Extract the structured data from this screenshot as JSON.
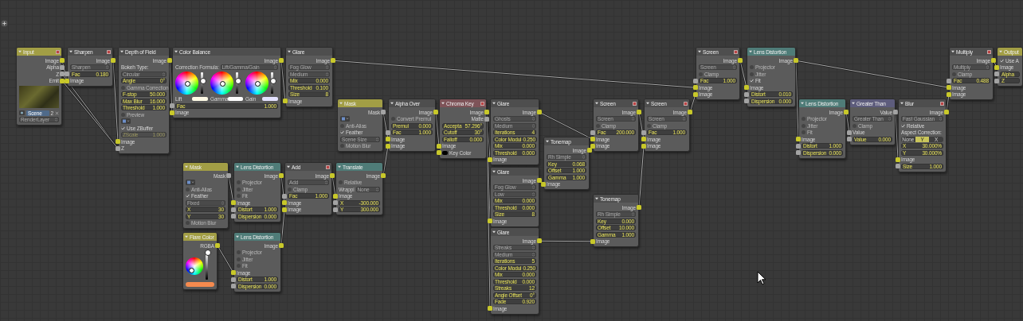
{
  "nodes": [
    {
      "title": "Input",
      "kind": "input",
      "has_header_icon": true,
      "rows": [
        {
          "kind": "out",
          "label": "Image",
          "socket": {
            "color": "#c8c82a"
          }
        },
        {
          "kind": "out",
          "label": "Alpha",
          "socket": {
            "color": "#a3a3a3"
          }
        },
        {
          "kind": "out",
          "label": "Z",
          "socket": {
            "color": "#a3a3a3"
          }
        },
        {
          "kind": "out",
          "label": "Emit",
          "socket": {
            "color": "#c8c82a"
          }
        },
        {
          "kind": "preview"
        },
        {
          "kind": "scene",
          "value": "Scene",
          "users": "2"
        },
        {
          "kind": "dropdown",
          "value": "RenderLayer"
        }
      ]
    },
    {
      "title": "Sharpen",
      "kind": "filter",
      "has_header_icon": true,
      "rows": [
        {
          "kind": "out",
          "label": "Image",
          "socket": {
            "color": "#c8c82a"
          }
        },
        {
          "kind": "dropdown",
          "value": "Sharpen"
        },
        {
          "kind": "field",
          "label": "Fac",
          "value": "0.180",
          "socket": {
            "color": "#a3a3a3"
          }
        },
        {
          "kind": "in",
          "label": "Image",
          "socket": {
            "color": "#c8c82a"
          }
        }
      ]
    },
    {
      "title": "Depth of Field",
      "kind": "filter",
      "rows": [
        {
          "kind": "out",
          "label": "Image",
          "socket": {
            "color": "#c8c82a"
          }
        },
        {
          "kind": "label",
          "label": "Bokeh Type:"
        },
        {
          "kind": "dropdown",
          "value": "Circular"
        },
        {
          "kind": "field",
          "label": "Angle",
          "value": "0°"
        },
        {
          "kind": "check",
          "label": "Gamma Correction",
          "checked": false
        },
        {
          "kind": "field",
          "label": "F-stop",
          "value": "50.000"
        },
        {
          "kind": "field",
          "label": "Max Blur",
          "value": "16.000"
        },
        {
          "kind": "field",
          "label": "Threshold",
          "value": "1.000"
        },
        {
          "kind": "check",
          "label": "Preview",
          "checked": false
        },
        {
          "kind": "icon_button"
        },
        {
          "kind": "check",
          "label": "Use ZBuffer",
          "checked": true
        },
        {
          "kind": "field",
          "label": "ZScale",
          "value": "1.000",
          "disabled": true
        },
        {
          "kind": "in",
          "label": "Image",
          "socket": {
            "color": "#c8c82a"
          }
        },
        {
          "kind": "in",
          "label": "Z",
          "socket": {
            "color": "#a3a3a3"
          }
        }
      ]
    },
    {
      "title": "Color Balance",
      "kind": "color",
      "rows": [
        {
          "kind": "out",
          "label": "Image",
          "socket": {
            "color": "#c8c82a"
          }
        },
        {
          "kind": "label_dropdown",
          "label": "Correction Formula:",
          "value": "Lift/Gamma/Gain"
        },
        {
          "kind": "wheels",
          "wheels": [
            {
              "label": "Lift",
              "color": "#fffbe6",
              "level": 0.55
            },
            {
              "label": "Gamma",
              "color": "#ffffff",
              "level": 0.55
            },
            {
              "label": "Gain",
              "color": "#e4e2ff",
              "level": 0.55
            }
          ]
        },
        {
          "kind": "field",
          "label": "Fac",
          "value": "1.000",
          "socket": {
            "color": "#a3a3a3"
          }
        },
        {
          "kind": "in",
          "label": "Image",
          "socket": {
            "color": "#c8c82a"
          }
        }
      ]
    },
    {
      "title": "Glare",
      "kind": "filter",
      "rows": [
        {
          "kind": "out",
          "label": "Image",
          "socket": {
            "color": "#c8c82a"
          }
        },
        {
          "kind": "dropdown",
          "value": "Fog Glow"
        },
        {
          "kind": "dropdown",
          "value": "Medium"
        },
        {
          "kind": "field",
          "label": "Mix",
          "value": "0.000"
        },
        {
          "kind": "field",
          "label": "Threshold",
          "value": "0.100"
        },
        {
          "kind": "field",
          "label": "Size",
          "value": "8"
        },
        {
          "kind": "in",
          "label": "Image",
          "socket": {
            "color": "#c8c82a"
          }
        }
      ]
    },
    {
      "title": "Screen",
      "kind": "color",
      "has_header_icon": true,
      "rows": [
        {
          "kind": "out",
          "label": "Image",
          "socket": {
            "color": "#c8c82a"
          }
        },
        {
          "kind": "dropdown",
          "value": "Screen"
        },
        {
          "kind": "check",
          "label": "Clamp",
          "checked": false
        },
        {
          "kind": "field",
          "label": "Fac",
          "value": "1.000",
          "socket": {
            "color": "#a3a3a3"
          }
        },
        {
          "kind": "in",
          "label": "Image",
          "socket": {
            "color": "#c8c82a"
          }
        },
        {
          "kind": "in",
          "label": "Image",
          "socket": {
            "color": "#c8c82a"
          }
        }
      ]
    },
    {
      "title": "Lens Distortion",
      "kind": "distort",
      "rows": [
        {
          "kind": "out",
          "label": "Image",
          "socket": {
            "color": "#c8c82a"
          }
        },
        {
          "kind": "check",
          "label": "Projector",
          "checked": false
        },
        {
          "kind": "check",
          "label": "Jitter",
          "checked": false
        },
        {
          "kind": "check",
          "label": "Fit",
          "checked": true
        },
        {
          "kind": "in",
          "label": "Image",
          "socket": {
            "color": "#c8c82a"
          }
        },
        {
          "kind": "field",
          "label": "Distort",
          "value": "0.010",
          "socket": {
            "color": "#a3a3a3"
          }
        },
        {
          "kind": "field",
          "label": "Dispersion",
          "value": "0.000",
          "socket": {
            "color": "#a3a3a3"
          }
        }
      ]
    },
    {
      "title": "Multiply",
      "kind": "color",
      "has_header_icon": true,
      "rows": [
        {
          "kind": "out",
          "label": "Image",
          "socket": {
            "color": "#c8c82a"
          }
        },
        {
          "kind": "dropdown",
          "value": "Multiply"
        },
        {
          "kind": "check",
          "label": "Clamp",
          "checked": false
        },
        {
          "kind": "field",
          "label": "Fac",
          "value": "0.488",
          "socket": {
            "color": "#a3a3a3"
          }
        },
        {
          "kind": "in",
          "label": "Image",
          "socket": {
            "color": "#c8c82a"
          }
        },
        {
          "kind": "in",
          "label": "Image",
          "socket": {
            "color": "#c8c82a"
          }
        }
      ]
    },
    {
      "title": "Output",
      "kind": "output",
      "rows": [
        {
          "kind": "check",
          "label": "Use A",
          "checked": true
        },
        {
          "kind": "in",
          "label": "Image",
          "socket": {
            "color": "#c8c82a"
          }
        },
        {
          "kind": "field",
          "label": "Alpha",
          "socket": {
            "color": "#a3a3a3"
          }
        },
        {
          "kind": "field",
          "label": "Z",
          "socket": {
            "color": "#a3a3a3"
          }
        }
      ]
    },
    {
      "title": "Mask",
      "kind": "input",
      "rows": [
        {
          "kind": "out",
          "label": "Mask",
          "socket": {
            "color": "#a3a3a3"
          }
        },
        {
          "kind": "icon_button"
        },
        {
          "kind": "check",
          "label": "Anti-Alias",
          "checked": false
        },
        {
          "kind": "check",
          "label": "Feather",
          "checked": true
        },
        {
          "kind": "dropdown",
          "value": "Scene Size"
        },
        {
          "kind": "check",
          "label": "Motion Blur",
          "checked": false
        }
      ]
    },
    {
      "title": "Alpha Over",
      "kind": "color",
      "rows": [
        {
          "kind": "out",
          "label": "Image",
          "socket": {
            "color": "#c8c82a"
          }
        },
        {
          "kind": "check",
          "label": "Convert Premul",
          "checked": false
        },
        {
          "kind": "field",
          "label": "Premul",
          "value": "0.000"
        },
        {
          "kind": "field",
          "label": "Fac",
          "value": "1.000",
          "socket": {
            "color": "#a3a3a3"
          }
        },
        {
          "kind": "in",
          "label": "Image",
          "socket": {
            "color": "#c8c82a"
          }
        },
        {
          "kind": "in",
          "label": "Image",
          "socket": {
            "color": "#c8c82a"
          }
        }
      ]
    },
    {
      "title": "Chroma Key",
      "kind": "matte",
      "has_header_icon": true,
      "rows": [
        {
          "kind": "out",
          "label": "Image",
          "socket": {
            "color": "#c8c82a"
          }
        },
        {
          "kind": "out",
          "label": "Matte",
          "socket": {
            "color": "#a3a3a3"
          }
        },
        {
          "kind": "field",
          "label": "Accepta",
          "value": "57.296°"
        },
        {
          "kind": "field",
          "label": "Cutoff",
          "value": "30°"
        },
        {
          "kind": "field",
          "label": "Falloff",
          "value": "0.000"
        },
        {
          "kind": "in",
          "label": "Image",
          "socket": {
            "color": "#c8c82a"
          }
        },
        {
          "kind": "in_swatch",
          "label": "Key Color",
          "color": "#000000",
          "socket": {
            "color": "#c8c82a"
          }
        }
      ]
    },
    {
      "title": "Glare",
      "kind": "filter",
      "rows": [
        {
          "kind": "out",
          "label": "Image",
          "socket": {
            "color": "#c8c82a"
          }
        },
        {
          "kind": "dropdown",
          "value": "Ghosts"
        },
        {
          "kind": "dropdown",
          "value": "Medium"
        },
        {
          "kind": "field",
          "label": "Iterations",
          "value": "4"
        },
        {
          "kind": "field",
          "label": "Color Modul",
          "value": "0.250"
        },
        {
          "kind": "field",
          "label": "Mix",
          "value": "0.000"
        },
        {
          "kind": "field",
          "label": "Threshold",
          "value": "0.000"
        },
        {
          "kind": "in",
          "label": "Image",
          "socket": {
            "color": "#c8c82a"
          }
        }
      ]
    },
    {
      "title": "Tonemap",
      "kind": "color",
      "rows": [
        {
          "kind": "out",
          "label": "Image",
          "socket": {
            "color": "#c8c82a"
          }
        },
        {
          "kind": "dropdown",
          "value": "Rh Simple"
        },
        {
          "kind": "field",
          "label": "Key",
          "value": "0.068"
        },
        {
          "kind": "field",
          "label": "Offset",
          "value": "1.000"
        },
        {
          "kind": "field",
          "label": "Gamma",
          "value": "1.000"
        },
        {
          "kind": "in",
          "label": "Image",
          "socket": {
            "color": "#c8c82a"
          }
        }
      ]
    },
    {
      "title": "Screen",
      "kind": "color",
      "has_header_icon": true,
      "rows": [
        {
          "kind": "out",
          "label": "Image",
          "socket": {
            "color": "#c8c82a"
          }
        },
        {
          "kind": "dropdown",
          "value": "Screen"
        },
        {
          "kind": "check",
          "label": "Clamp",
          "checked": false
        },
        {
          "kind": "field",
          "label": "Fac",
          "value": "200.000",
          "socket": {
            "color": "#a3a3a3"
          }
        },
        {
          "kind": "in",
          "label": "Image",
          "socket": {
            "color": "#c8c82a"
          }
        },
        {
          "kind": "in",
          "label": "Image",
          "socket": {
            "color": "#c8c82a"
          }
        }
      ]
    },
    {
      "title": "Screen",
      "kind": "color",
      "has_header_icon": true,
      "rows": [
        {
          "kind": "out",
          "label": "Image",
          "socket": {
            "color": "#c8c82a"
          }
        },
        {
          "kind": "dropdown",
          "value": "Screen"
        },
        {
          "kind": "check",
          "label": "Clamp",
          "checked": false
        },
        {
          "kind": "field",
          "label": "Fac",
          "value": "1.000",
          "socket": {
            "color": "#a3a3a3"
          }
        },
        {
          "kind": "in",
          "label": "Image",
          "socket": {
            "color": "#c8c82a"
          }
        },
        {
          "kind": "in",
          "label": "Image",
          "socket": {
            "color": "#c8c82a"
          }
        }
      ]
    },
    {
      "title": "Glare",
      "kind": "filter",
      "rows": [
        {
          "kind": "out",
          "label": "Image",
          "socket": {
            "color": "#c8c82a"
          }
        },
        {
          "kind": "dropdown",
          "value": "Fog Glow"
        },
        {
          "kind": "dropdown",
          "value": "Low"
        },
        {
          "kind": "field",
          "label": "Mix",
          "value": "0.000"
        },
        {
          "kind": "field",
          "label": "Threshold",
          "value": "0.000"
        },
        {
          "kind": "field",
          "label": "Size",
          "value": "8"
        },
        {
          "kind": "in",
          "label": "Image",
          "socket": {
            "color": "#c8c82a"
          }
        }
      ]
    },
    {
      "title": "Tonemap",
      "kind": "color",
      "rows": [
        {
          "kind": "out",
          "label": "Image",
          "socket": {
            "color": "#c8c82a"
          }
        },
        {
          "kind": "dropdown",
          "value": "Rh Simple"
        },
        {
          "kind": "field",
          "label": "Key",
          "value": "0.000"
        },
        {
          "kind": "field",
          "label": "Offset",
          "value": "10.000"
        },
        {
          "kind": "field",
          "label": "Gamma",
          "value": "1.000"
        },
        {
          "kind": "in",
          "label": "Image",
          "socket": {
            "color": "#c8c82a"
          }
        }
      ]
    },
    {
      "title": "Glare",
      "kind": "filter",
      "rows": [
        {
          "kind": "out",
          "label": "Image",
          "socket": {
            "color": "#c8c82a"
          }
        },
        {
          "kind": "dropdown",
          "value": "Streaks"
        },
        {
          "kind": "dropdown",
          "value": "Medium"
        },
        {
          "kind": "field",
          "label": "Iterations",
          "value": "5"
        },
        {
          "kind": "field",
          "label": "Color Modul",
          "value": "0.250"
        },
        {
          "kind": "field",
          "label": "Mix",
          "value": "0.000"
        },
        {
          "kind": "field",
          "label": "Threshold",
          "value": "0.000"
        },
        {
          "kind": "field",
          "label": "Streaks",
          "value": "12"
        },
        {
          "kind": "field",
          "label": "Angle Offset",
          "value": "0°"
        },
        {
          "kind": "field",
          "label": "Fade",
          "value": "0.920"
        },
        {
          "kind": "in",
          "label": "Image",
          "socket": {
            "color": "#c8c82a"
          }
        }
      ]
    },
    {
      "title": "Lens Distortion",
      "kind": "distort",
      "rows": [
        {
          "kind": "out",
          "label": "Image",
          "socket": {
            "color": "#c8c82a"
          }
        },
        {
          "kind": "check",
          "label": "Projector",
          "checked": false
        },
        {
          "kind": "check",
          "label": "Jitter",
          "checked": false
        },
        {
          "kind": "check",
          "label": "Fit",
          "checked": false
        },
        {
          "kind": "in",
          "label": "Image",
          "socket": {
            "color": "#c8c82a"
          }
        },
        {
          "kind": "field",
          "label": "Distort",
          "value": "1.000",
          "socket": {
            "color": "#a3a3a3"
          }
        },
        {
          "kind": "field",
          "label": "Dispersion",
          "value": "0.000",
          "socket": {
            "color": "#a3a3a3"
          }
        }
      ]
    },
    {
      "title": "Greater Than",
      "kind": "converter",
      "rows": [
        {
          "kind": "out",
          "label": "Value",
          "socket": {
            "color": "#a3a3a3"
          }
        },
        {
          "kind": "dropdown",
          "value": "Greater Than"
        },
        {
          "kind": "check",
          "label": "Clamp",
          "checked": false
        },
        {
          "kind": "in",
          "label": "Value",
          "socket": {
            "color": "#a3a3a3"
          }
        },
        {
          "kind": "field",
          "label": "Value",
          "value": "0.000",
          "socket": {
            "color": "#a3a3a3"
          }
        }
      ]
    },
    {
      "title": "Blur",
      "kind": "filter",
      "has_header_icon": true,
      "rows": [
        {
          "kind": "out",
          "label": "Image",
          "socket": {
            "color": "#c8c82a"
          }
        },
        {
          "kind": "dropdown",
          "value": "Fast Gaussian"
        },
        {
          "kind": "check",
          "label": "Relative",
          "checked": true
        },
        {
          "kind": "label",
          "label": "Aspect Correction:"
        },
        {
          "kind": "segment",
          "options": [
            {
              "label": "None",
              "selected": false
            },
            {
              "label": "Y",
              "selected": true
            },
            {
              "label": "X",
              "selected": false
            }
          ]
        },
        {
          "kind": "field",
          "label": "X",
          "value": "30.000%"
        },
        {
          "kind": "field",
          "label": "Y",
          "value": "30.000%"
        },
        {
          "kind": "in",
          "label": "Image",
          "socket": {
            "color": "#c8c82a"
          }
        },
        {
          "kind": "field",
          "label": "Size",
          "value": "1.000",
          "socket": {
            "color": "#a3a3a3"
          }
        }
      ]
    },
    {
      "title": "Mask",
      "kind": "input",
      "rows": [
        {
          "kind": "out",
          "label": "Mask",
          "socket": {
            "color": "#a3a3a3"
          }
        },
        {
          "kind": "icon_button"
        },
        {
          "kind": "check",
          "label": "Anti-Alias",
          "checked": false
        },
        {
          "kind": "check",
          "label": "Feather",
          "checked": true
        },
        {
          "kind": "dropdown",
          "value": "Fixed"
        },
        {
          "kind": "field",
          "label": "X",
          "value": "30"
        },
        {
          "kind": "field",
          "label": "Y",
          "value": "30"
        },
        {
          "kind": "check",
          "label": "Motion Blur",
          "checked": false
        }
      ]
    },
    {
      "title": "Lens Distortion",
      "kind": "distort",
      "rows": [
        {
          "kind": "out",
          "label": "Image",
          "socket": {
            "color": "#c8c82a"
          }
        },
        {
          "kind": "check",
          "label": "Projector",
          "checked": false
        },
        {
          "kind": "check",
          "label": "Jitter",
          "checked": false
        },
        {
          "kind": "check",
          "label": "Fit",
          "checked": false
        },
        {
          "kind": "in",
          "label": "Image",
          "socket": {
            "color": "#c8c82a"
          }
        },
        {
          "kind": "field",
          "label": "Distort",
          "value": "1.000",
          "socket": {
            "color": "#a3a3a3"
          }
        },
        {
          "kind": "field",
          "label": "Dispersion",
          "value": "0.000",
          "socket": {
            "color": "#a3a3a3"
          }
        }
      ]
    },
    {
      "title": "Add",
      "kind": "color",
      "has_header_icon": true,
      "rows": [
        {
          "kind": "out",
          "label": "Image",
          "socket": {
            "color": "#c8c82a"
          }
        },
        {
          "kind": "dropdown",
          "value": "Add"
        },
        {
          "kind": "check",
          "label": "Clamp",
          "checked": false
        },
        {
          "kind": "field",
          "label": "Fac",
          "value": "1.000",
          "socket": {
            "color": "#a3a3a3"
          }
        },
        {
          "kind": "in",
          "label": "Image",
          "socket": {
            "color": "#c8c82a"
          }
        },
        {
          "kind": "in",
          "label": "Image",
          "socket": {
            "color": "#c8c82a"
          }
        }
      ]
    },
    {
      "title": "Translate",
      "kind": "distort",
      "rows": [
        {
          "kind": "out",
          "label": "Image",
          "socket": {
            "color": "#c8c82a"
          }
        },
        {
          "kind": "check",
          "label": "Relative",
          "checked": false
        },
        {
          "kind": "label_dropdown",
          "label": "Wrappi",
          "value": "None"
        },
        {
          "kind": "in",
          "label": "Image",
          "socket": {
            "color": "#c8c82a"
          }
        },
        {
          "kind": "field",
          "label": "X",
          "value": "-300.000",
          "socket": {
            "color": "#a3a3a3"
          }
        },
        {
          "kind": "field",
          "label": "Y",
          "value": "300.000",
          "socket": {
            "color": "#a3a3a3"
          }
        }
      ]
    },
    {
      "title": "Flare Color",
      "kind": "input",
      "rows": [
        {
          "kind": "out",
          "label": "RGBA",
          "socket": {
            "color": "#c8c82a"
          }
        },
        {
          "kind": "picker",
          "level": 0.95
        },
        {
          "kind": "swatch",
          "color": "#f58a4e"
        }
      ]
    },
    {
      "title": "Lens Distortion",
      "kind": "distort",
      "rows": [
        {
          "kind": "out",
          "label": "Image",
          "socket": {
            "color": "#c8c82a"
          }
        },
        {
          "kind": "check",
          "label": "Projector",
          "checked": false
        },
        {
          "kind": "check",
          "label": "Jitter",
          "checked": false
        },
        {
          "kind": "check",
          "label": "Fit",
          "checked": false
        },
        {
          "kind": "in",
          "label": "Image",
          "socket": {
            "color": "#c8c82a"
          }
        },
        {
          "kind": "field",
          "label": "Distort",
          "value": "1.000",
          "socket": {
            "color": "#a3a3a3"
          }
        },
        {
          "kind": "field",
          "label": "Dispersion",
          "value": "0.000",
          "socket": {
            "color": "#a3a3a3"
          }
        }
      ]
    }
  ]
}
